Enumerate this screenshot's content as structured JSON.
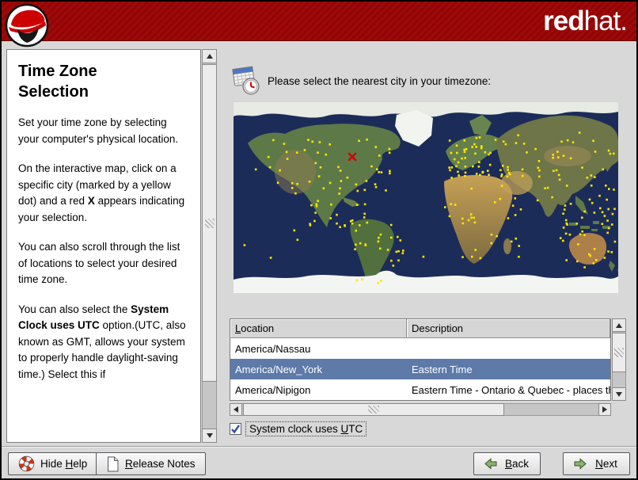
{
  "header": {
    "brand_bold": "red",
    "brand_light": "hat."
  },
  "help_panel": {
    "title": "Time Zone Selection",
    "paragraphs": [
      [
        {
          "t": "Set your time zone by selecting your computer's physical location."
        }
      ],
      [
        {
          "t": "On the interactive map, click on a specific city (marked by a yellow dot) and a red "
        },
        {
          "t": "X",
          "b": true
        },
        {
          "t": " appears indicating your selection."
        }
      ],
      [
        {
          "t": "You can also scroll through the list of locations to select your desired time zone."
        }
      ],
      [
        {
          "t": "You can also select the "
        },
        {
          "t": "System Clock uses UTC",
          "b": true
        },
        {
          "t": " option.(UTC, also known as GMT, allows your system to properly handle daylight-saving time.) Select this if"
        }
      ]
    ]
  },
  "main": {
    "prompt": "Please select the nearest city in your timezone:",
    "table": {
      "location_header_accel": "L",
      "location_header_rest": "ocation",
      "description_header": "Description",
      "selected_row": "America/New_York",
      "rows": [
        {
          "location": "America/Nassau",
          "description": ""
        },
        {
          "location": "America/New_York",
          "description": "Eastern Time"
        },
        {
          "location": "America/Nipigon",
          "description": "Eastern Time - Ontario & Quebec - places th"
        }
      ]
    },
    "utc_checkbox": {
      "checked": true,
      "pre": "System clock uses ",
      "accel": "U",
      "post": "TC"
    }
  },
  "footer": {
    "hide_help": {
      "pre": "Hide ",
      "accel": "H",
      "post": "elp"
    },
    "release_notes": {
      "pre": "",
      "accel": "R",
      "post": "elease Notes"
    },
    "back": {
      "pre": "",
      "accel": "B",
      "post": "ack"
    },
    "next": {
      "pre": "",
      "accel": "N",
      "post": "ext"
    }
  },
  "colors": {
    "banner_red": "#9e0808",
    "selection_blue": "#5d7aa9",
    "city_dot_yellow": "#ffe600",
    "marker_red": "#d40000",
    "ocean_navy": "#1c2c59"
  }
}
